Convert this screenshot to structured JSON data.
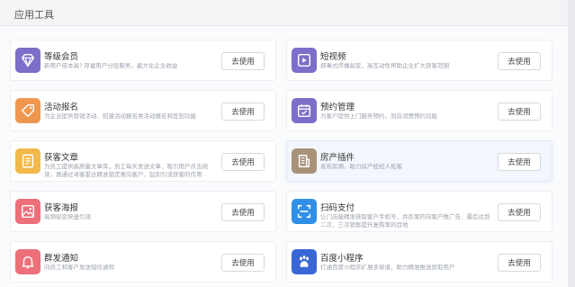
{
  "page": {
    "title": "应用工具"
  },
  "colors": {
    "membership": "#7b6fc9",
    "activity": "#f0974f",
    "article": "#f2b94a",
    "poster": "#ec6f7a",
    "notice": "#ec6f7a",
    "video": "#7b6fc9",
    "booking": "#7b6fc9",
    "property": "#a8927a",
    "scanpay": "#2f8fe8",
    "baidu": "#3a66d6"
  },
  "cards": [
    {
      "name": "等级会员",
      "desc": "新用户成本高? 存量用户分层服务，最大化企业收益",
      "button": "去使用",
      "icon": "diamond-icon"
    },
    {
      "name": "短视频",
      "desc": "病毒式传播裂变、高互动性帮助企业扩大获客范围",
      "button": "去使用",
      "icon": "video-icon"
    },
    {
      "name": "活动报名",
      "desc": "为企业提供营销活动、招建活动报名类活动报名和签到功能",
      "button": "去使用",
      "icon": "tag-icon"
    },
    {
      "name": "预约管理",
      "desc": "为客户提供上门服务预约，到店消费预约功能",
      "button": "去使用",
      "icon": "calendar-icon"
    },
    {
      "name": "获客文章",
      "desc": "为员工提供高质量文章库，员工每天发送文章，吸引用户点击阅读，再通过寻客雷达精准锁定意向客户，起到引流获客的作用",
      "button": "去使用",
      "icon": "document-icon"
    },
    {
      "name": "房产插件",
      "desc": "发布房源、助力房产经纪人拓客",
      "button": "去使用",
      "icon": "building-icon"
    },
    {
      "name": "获客海报",
      "desc": "高频裂变快速引流",
      "button": "去使用",
      "icon": "picture-icon"
    },
    {
      "name": "扫码支付",
      "desc": "让门店能精准获取客户手机号，并反聚的向客户推广告、最后达到二次、三次销售提升复购率的目地",
      "button": "去使用",
      "icon": "scan-icon"
    },
    {
      "name": "群发通知",
      "desc": "向员工和客户发送短信通知",
      "button": "去使用",
      "icon": "bell-icon"
    },
    {
      "name": "百度小程序",
      "desc": "打通百度小程序扩展多渠道，助力精准推送获取用户",
      "button": "去使用",
      "icon": "baidu-paw-icon"
    }
  ]
}
